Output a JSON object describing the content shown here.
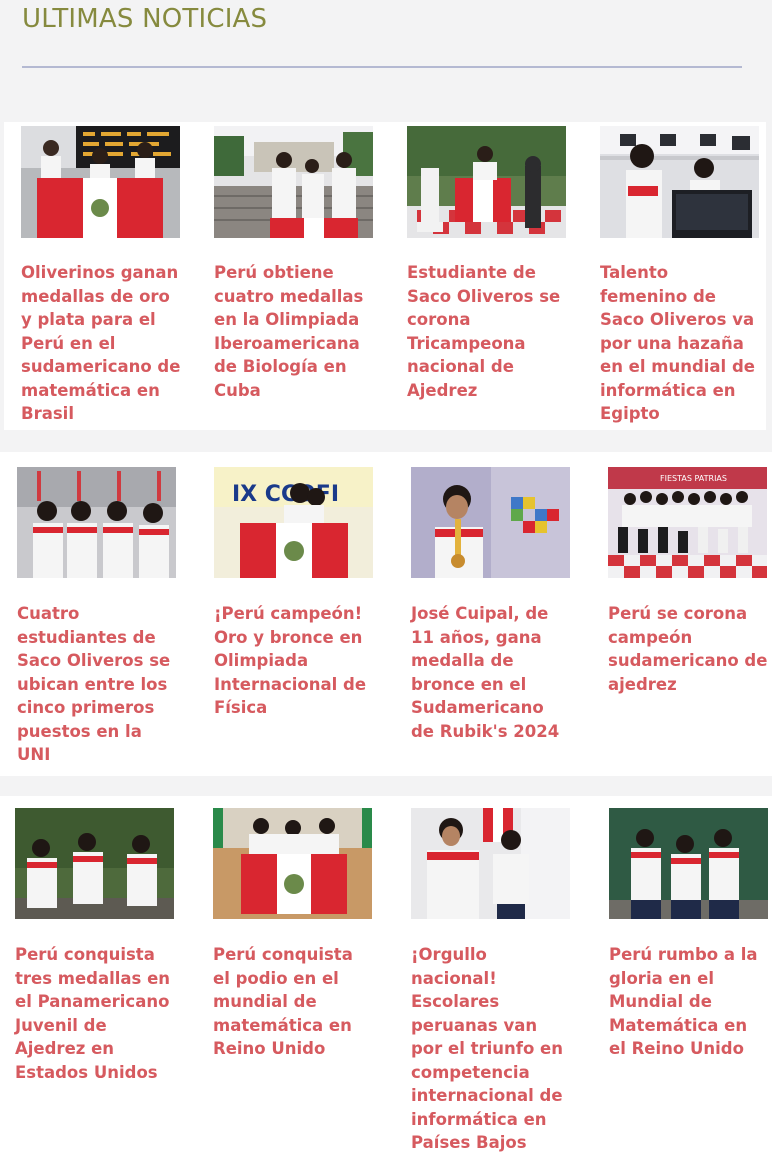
{
  "section": {
    "title": "ULTIMAS NOTICIAS"
  },
  "colors": {
    "title": "#868a3e",
    "rule": "#b4b9d2",
    "headline": "#d65a5f",
    "peru_red": "#d92630",
    "background": "#f3f3f4"
  },
  "articles": [
    [
      {
        "headline": "Oliverinos ganan medallas de oro y plata para el Perú en el sudamericano de matemática en Brasil",
        "image": "students-with-peru-flag-at-airport"
      },
      {
        "headline": "Perú obtiene cuatro medallas en la Olimpiada Iberoamericana de Biología en Cuba",
        "image": "students-on-university-steps"
      },
      {
        "headline": "Estudiante de Saco Oliveros se corona Tricampeona nacional de Ajedrez",
        "image": "student-with-giant-chess-pieces"
      },
      {
        "headline": "Talento femenino de Saco Oliveros va por una hazaña en el mundial de informática en Egipto",
        "image": "students-in-computer-lab"
      }
    ],
    [
      {
        "headline": "Cuatro estudiantes de Saco Oliveros se ubican entre los cinco primeros puestos en la UNI",
        "image": "four-students-thumbs-up"
      },
      {
        "headline": "¡Perú campeón! Oro y bronce en Olimpiada Internacional de Física",
        "image": "students-with-flag-physics-olympiad"
      },
      {
        "headline": "José Cuipal, de 11 años, gana medalla de bronce en el Sudamericano de Rubik's 2024",
        "image": "boy-with-medal-rubik"
      },
      {
        "headline": "Perú se corona campeón sudamericano de ajedrez",
        "image": "chess-team-group"
      }
    ],
    [
      {
        "headline": "Perú conquista tres medallas en el Panamericano Juvenil de Ajedrez en Estados Unidos",
        "image": "three-students-outdoors"
      },
      {
        "headline": "Perú conquista el podio en el mundial de matemática en Reino Unido",
        "image": "students-with-flag-gym"
      },
      {
        "headline": "¡Orgullo nacional! Escolares peruanas van por el triunfo en competencia internacional de informática en Países Bajos",
        "image": "two-students-with-flag-indoors"
      },
      {
        "headline": "Perú rumbo a la gloria en el Mundial de Matemática en el Reino Unido",
        "image": "three-students-chalkboard"
      }
    ]
  ]
}
